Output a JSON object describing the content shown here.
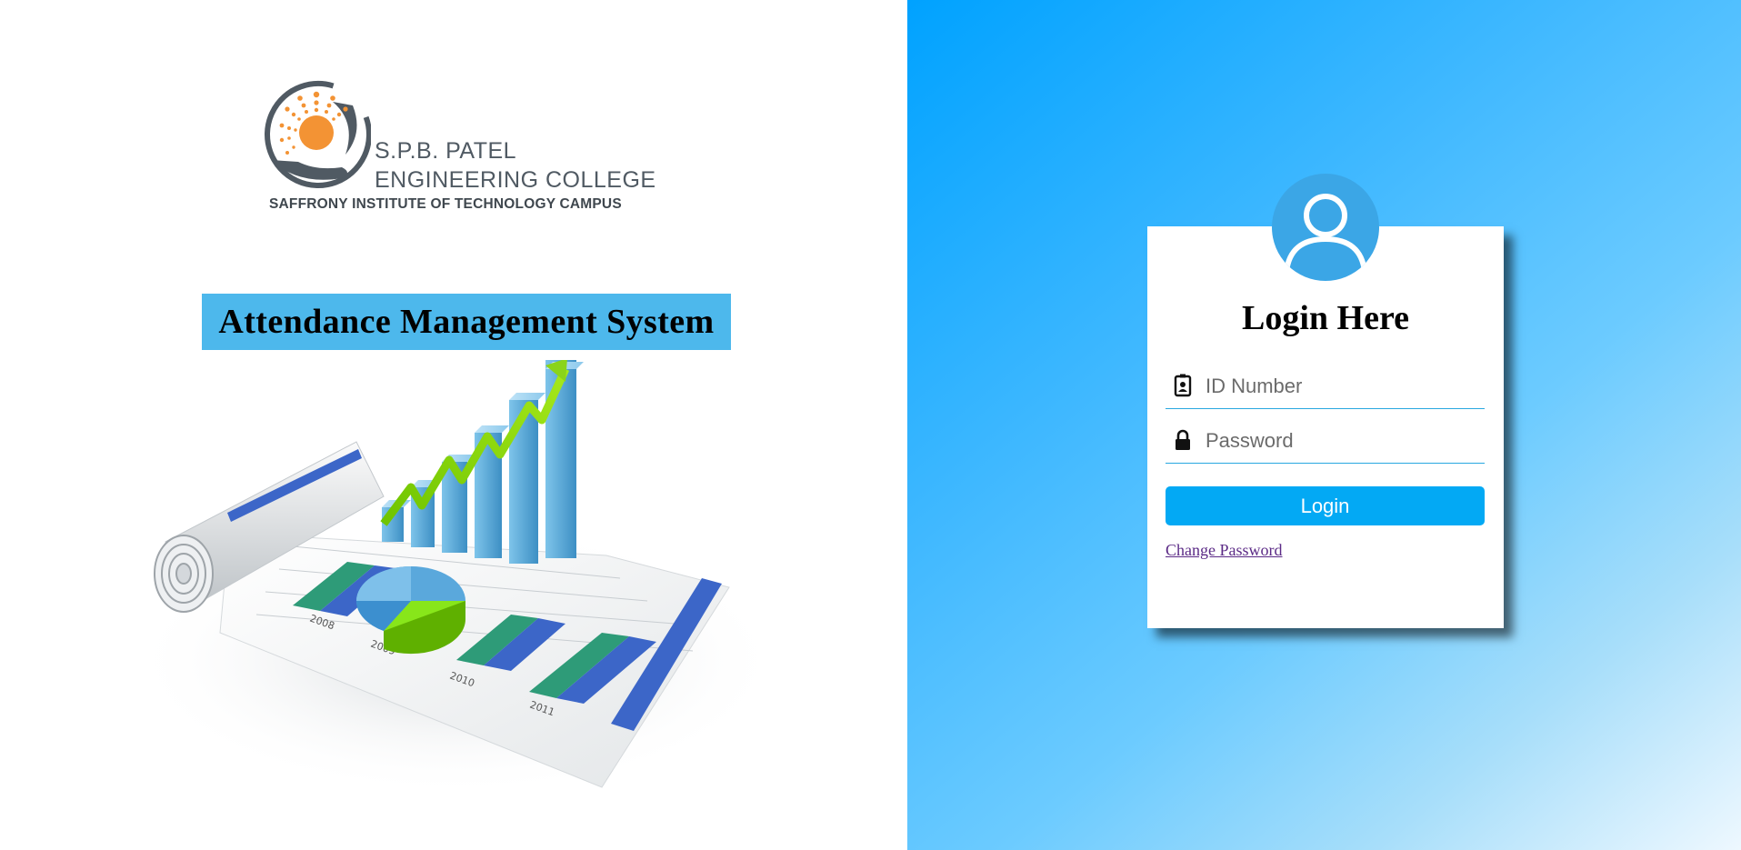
{
  "logo": {
    "line1": "S.P.B. PATEL",
    "line2": "ENGINEERING COLLEGE",
    "line3": "SAFFRONY INSTITUTE OF TECHNOLOGY CAMPUS",
    "colors": {
      "sun": "#f39334",
      "ring": "#505a63"
    }
  },
  "banner": {
    "title": "Attendance Management System",
    "background": "#4db8ec"
  },
  "hero_illustration": {
    "icon": "growth-chart-illustration",
    "year_labels": [
      "2008",
      "2009",
      "2010",
      "2011"
    ]
  },
  "login": {
    "avatar_icon": "user-icon",
    "heading": "Login Here",
    "id_field": {
      "icon": "id-badge-icon",
      "placeholder": "ID Number",
      "value": ""
    },
    "password_field": {
      "icon": "lock-icon",
      "placeholder": "Password",
      "value": ""
    },
    "submit_label": "Login",
    "change_password_label": "Change Password",
    "colors": {
      "button": "#03a9f4",
      "avatar": "#3ba6e6",
      "underline": "#29a8e0"
    }
  }
}
